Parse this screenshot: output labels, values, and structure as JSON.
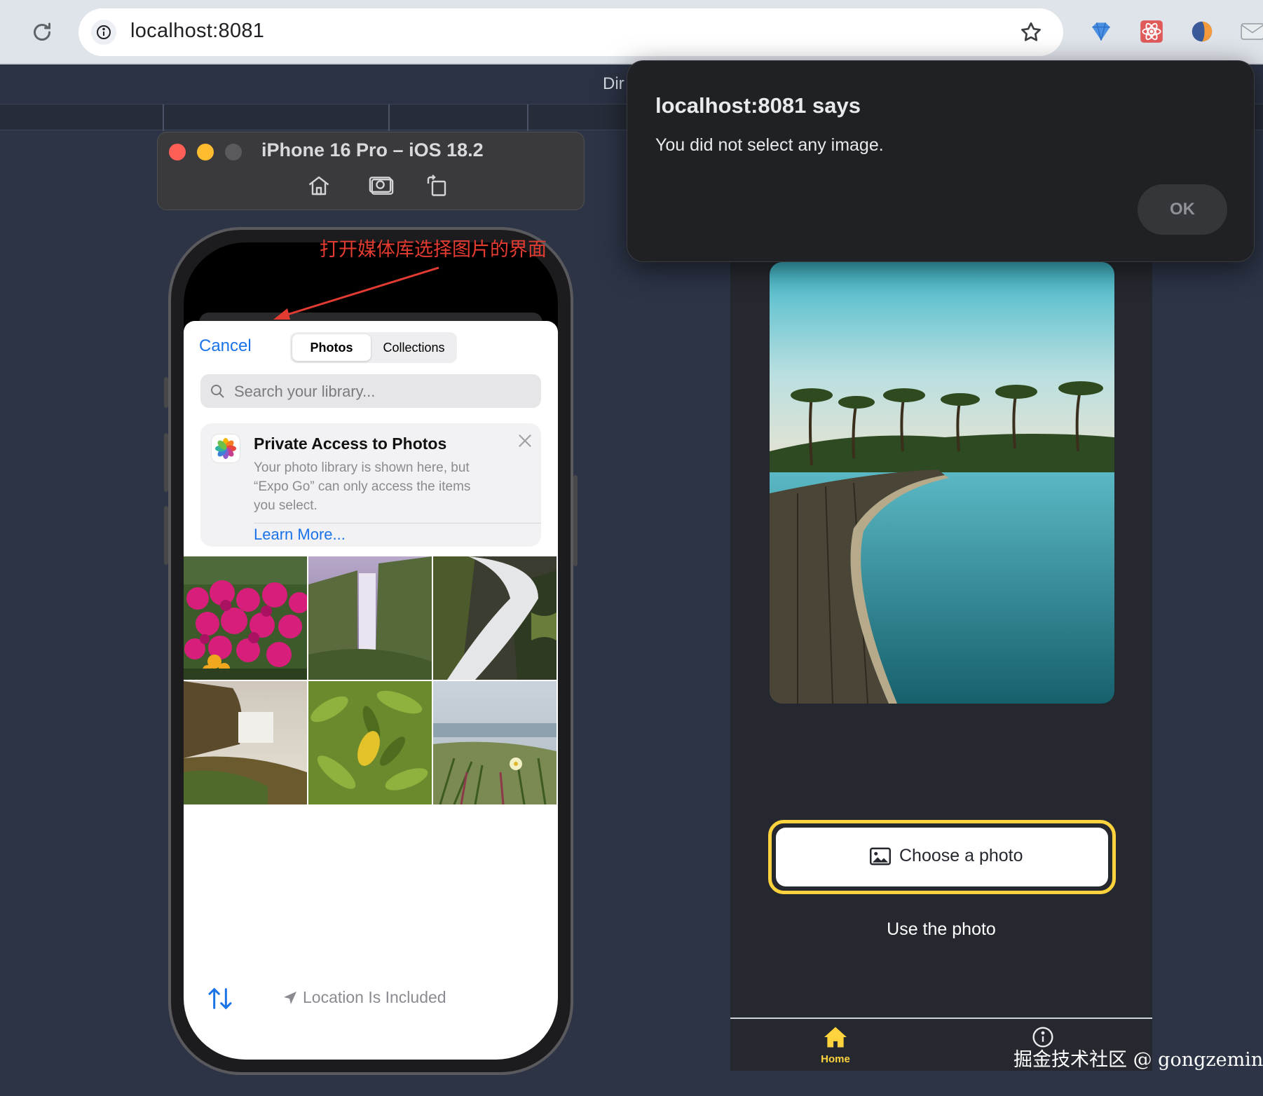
{
  "browser": {
    "url": "localhost:8081"
  },
  "devtools": {
    "strip_label": "Dir"
  },
  "simulator": {
    "title": "iPhone 16 Pro – iOS 18.2",
    "traffic_lights": [
      "#ff5f57",
      "#febc2e",
      "#5a5a5e"
    ]
  },
  "annotation": {
    "text": "打开媒体库选择图片的界面",
    "color": "#e23b32"
  },
  "picker": {
    "cancel": "Cancel",
    "tabs": [
      {
        "label": "Photos",
        "selected": true
      },
      {
        "label": "Collections",
        "selected": false
      }
    ],
    "search_placeholder": "Search your library...",
    "card": {
      "title": "Private Access to Photos",
      "body": "Your photo library is shown here, but “Expo Go” can only access the items you select.",
      "link": "Learn More..."
    },
    "photos": [
      "flowers",
      "waterfall-valley",
      "waterfall-rocks",
      "waterfall-cliff",
      "green-leaves",
      "coastal-plants"
    ],
    "footer": "Location Is Included"
  },
  "app": {
    "hero_image": "tropical-boardwalk",
    "choose_button": "Choose a photo",
    "use_photo": "Use the photo",
    "tab_home": "Home",
    "accent": "#ffd33d",
    "background": "#25292f"
  },
  "dialog": {
    "title": "localhost:8081 says",
    "message": "You did not select any image.",
    "ok": "OK"
  },
  "watermark": "掘金技术社区 @ gongzemin"
}
